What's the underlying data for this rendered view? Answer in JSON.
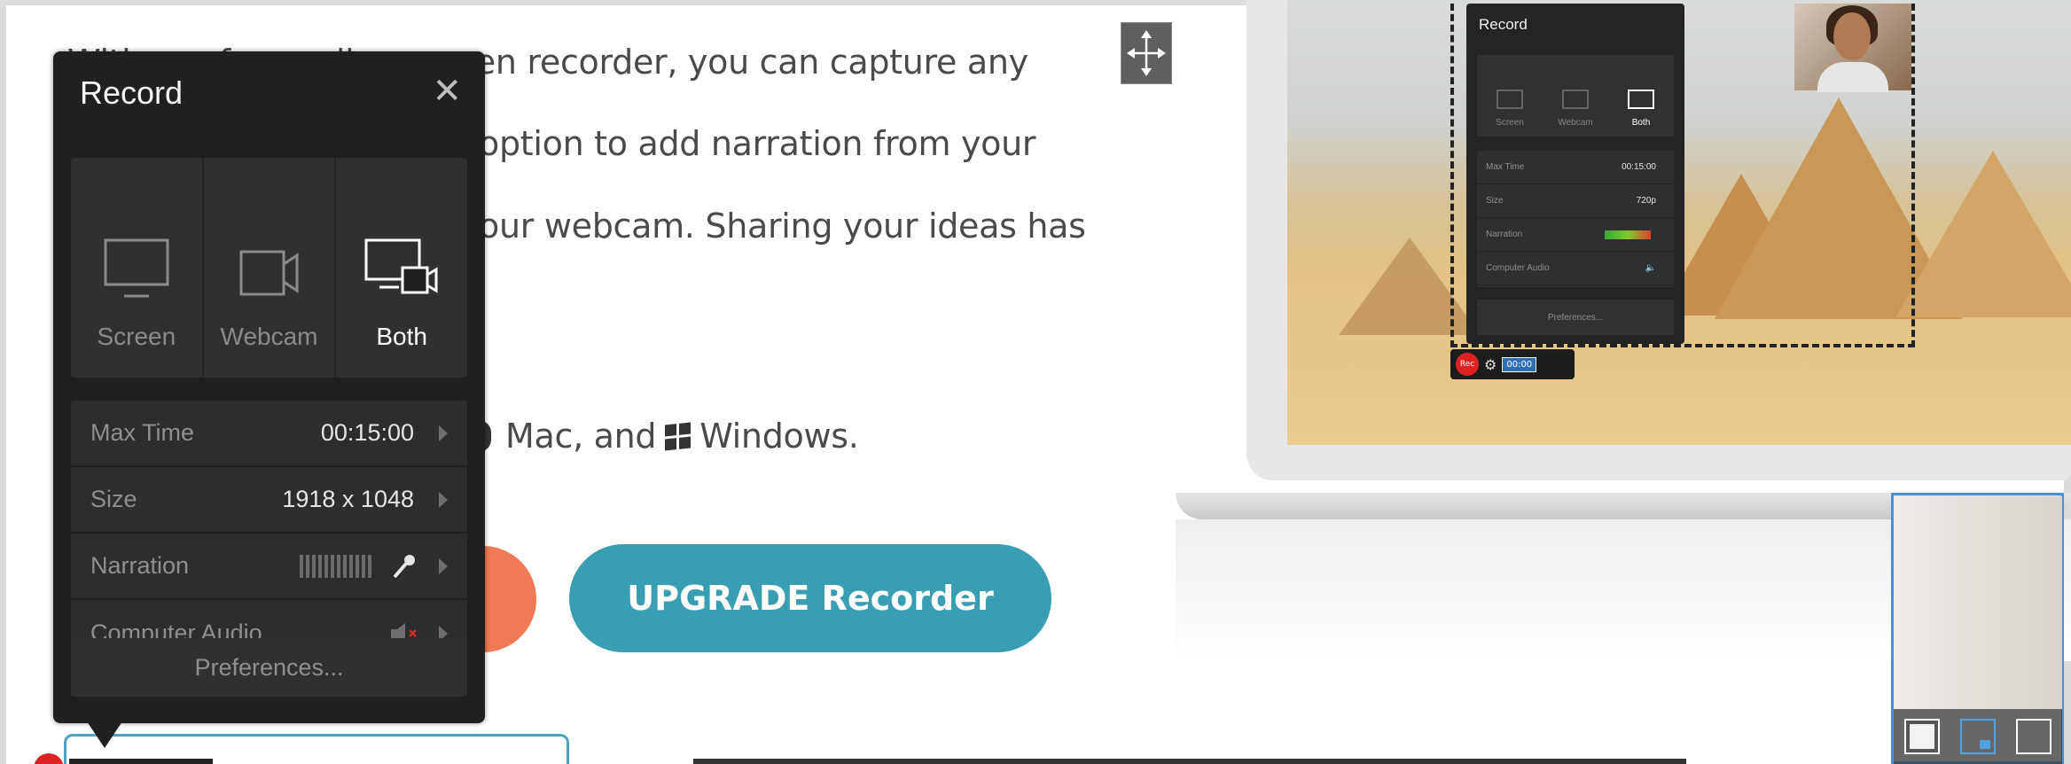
{
  "article": {
    "line1": "With our free online screen recorder, you can capture any",
    "line2": "option to add narration from your",
    "line3": "our webcam. Sharing your ideas has",
    "line4_mac": "Mac, and",
    "line4_windows": "Windows.",
    "upgrade_button": "UPGRADE Recorder"
  },
  "record_panel": {
    "title": "Record",
    "close_glyph": "✕",
    "modes": [
      {
        "label": "Screen",
        "icon": "monitor-icon",
        "active": false
      },
      {
        "label": "Webcam",
        "icon": "webcam-icon",
        "active": false
      },
      {
        "label": "Both",
        "icon": "monitor-webcam-icon",
        "active": true
      }
    ],
    "settings": [
      {
        "label": "Max Time",
        "value": "00:15:00"
      },
      {
        "label": "Size",
        "value": "1918 x 1048"
      },
      {
        "label": "Narration",
        "value": ""
      },
      {
        "label": "Computer Audio",
        "value": ""
      }
    ],
    "preferences": "Preferences..."
  },
  "preview": {
    "panel_title": "Record",
    "modes": [
      "Screen",
      "Webcam",
      "Both"
    ],
    "rows": [
      {
        "label": "Max Time",
        "value": "00:15:00"
      },
      {
        "label": "Size",
        "value": "720p"
      },
      {
        "label": "Narration",
        "value": ""
      },
      {
        "label": "Computer Audio",
        "value": ""
      }
    ],
    "preferences": "Preferences...",
    "rec_label": "Rec",
    "timer": "00:00"
  },
  "colors": {
    "upgrade": "#3a9eb2",
    "orange": "#f07a53",
    "panel_bg": "#1f2021",
    "accent_blue": "#4a90d9"
  }
}
